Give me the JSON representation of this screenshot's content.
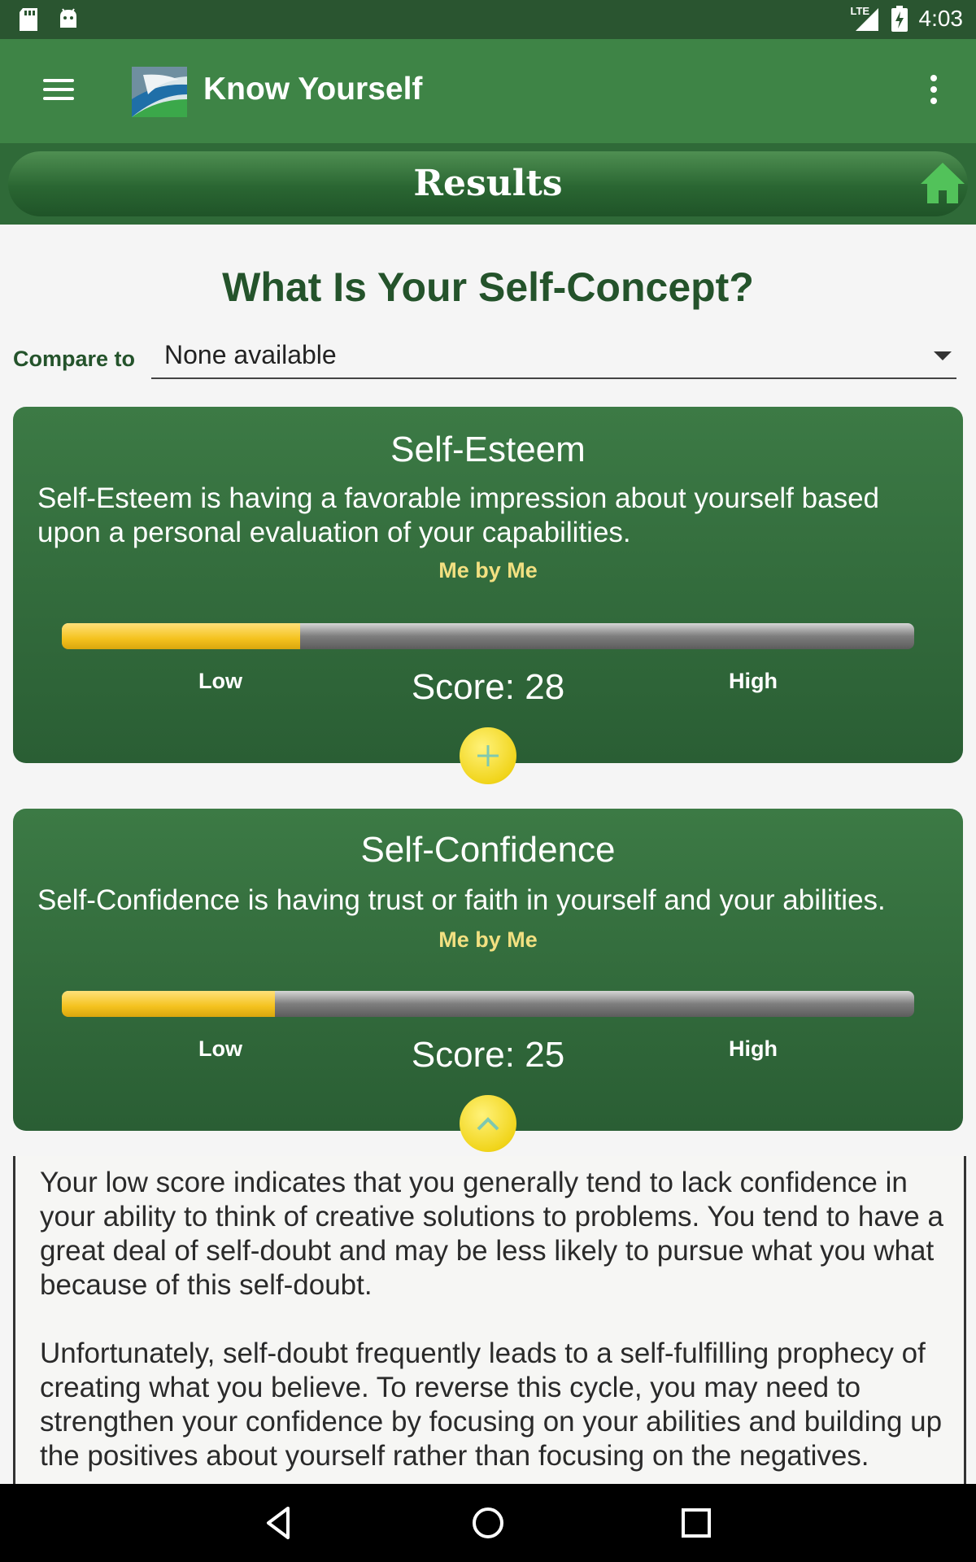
{
  "status_bar": {
    "time": "4:03",
    "network": "LTE"
  },
  "app_bar": {
    "title": "Know Yourself"
  },
  "results_bar": {
    "title": "Results"
  },
  "page": {
    "title": "What Is Your Self-Concept?",
    "compare_label": "Compare to",
    "compare_value": "None available"
  },
  "cards": [
    {
      "title": "Self-Esteem",
      "description": "Self-Esteem is having a favorable impression about yourself based upon a personal evaluation of your capabilities.",
      "subtitle": "Me by Me",
      "low_label": "Low",
      "high_label": "High",
      "score_label": "Score: 28",
      "fill_fraction": 0.28,
      "toggle_icon": "plus-icon"
    },
    {
      "title": "Self-Confidence",
      "description": "Self-Confidence is having trust or faith in yourself and your abilities.",
      "subtitle": "Me by Me",
      "low_label": "Low",
      "high_label": "High",
      "score_label": "Score: 25",
      "fill_fraction": 0.25,
      "toggle_icon": "chevron-up-icon"
    }
  ],
  "detail": {
    "paragraphs": [
      "Your low score indicates that you generally tend to lack confidence in your ability to think of creative solutions to problems. You tend to have a great deal of self-doubt and may be less likely to pursue what you what because of this self-doubt.",
      "Unfortunately, self-doubt frequently leads to a self-fulfilling prophecy of creating what you believe. To reverse this cycle, you may need to strengthen your confidence by focusing on your abilities and building up the positives about yourself rather than focusing on the negatives."
    ]
  },
  "colors": {
    "primary": "#3e8446",
    "dark": "#2a5530",
    "accent": "#f4c21e",
    "sub": "#f2e081"
  }
}
